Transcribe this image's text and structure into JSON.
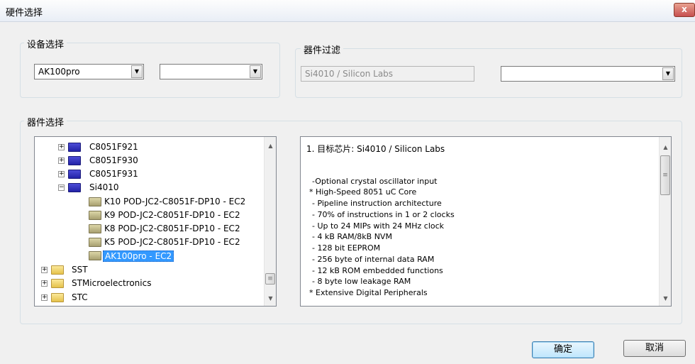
{
  "window": {
    "title": "硬件选择",
    "close_glyph": "x"
  },
  "device_group": {
    "label": "设备选择",
    "combo1_value": "AK100pro",
    "combo2_value": ""
  },
  "filter_group": {
    "label": "器件过滤",
    "text_value": "Si4010 / Silicon Labs",
    "combo_value": ""
  },
  "select_group": {
    "label": "器件选择"
  },
  "tree": {
    "items": [
      {
        "label": "C8051F921",
        "icon": "folder-closed-icon"
      },
      {
        "label": "C8051F930",
        "icon": "folder-closed-icon"
      },
      {
        "label": "C8051F931",
        "icon": "folder-closed-icon"
      },
      {
        "label": "Si4010",
        "icon": "folder-closed-icon"
      },
      {
        "label": "K10  POD-JC2-C8051F-DP10  - EC2",
        "icon": "folder-closed-icon"
      },
      {
        "label": "K9  POD-JC2-C8051F-DP10  - EC2",
        "icon": "folder-closed-icon"
      },
      {
        "label": "K8  POD-JC2-C8051F-DP10  - EC2",
        "icon": "folder-closed-icon"
      },
      {
        "label": "K5  POD-JC2-C8051F-DP10  - EC2",
        "icon": "folder-closed-icon"
      },
      {
        "label": "AK100pro    - EC2",
        "icon": "folder-open-icon"
      },
      {
        "label": "SST",
        "icon": "folder-closed-icon"
      },
      {
        "label": "STMicroelectronics",
        "icon": "folder-closed-icon"
      },
      {
        "label": "STC",
        "icon": "folder-closed-icon"
      }
    ]
  },
  "info": {
    "lines": [
      "1. 目标芯片: Si4010 / Silicon Labs",
      "",
      "",
      "-Optional crystal oscillator input",
      "* High-Speed 8051 uC Core",
      "- Pipeline instruction architecture",
      "- 70% of instructions in 1 or 2 clocks",
      "- Up to 24 MIPs with 24 MHz clock",
      "- 4 kB RAM/8kB NVM",
      "- 128 bit EEPROM",
      "- 256 byte of internal data RAM",
      "- 12 kB ROM embedded functions",
      "- 8 byte low leakage RAM",
      "* Extensive Digital Peripherals"
    ]
  },
  "buttons": {
    "ok": "确定",
    "cancel": "取消"
  }
}
